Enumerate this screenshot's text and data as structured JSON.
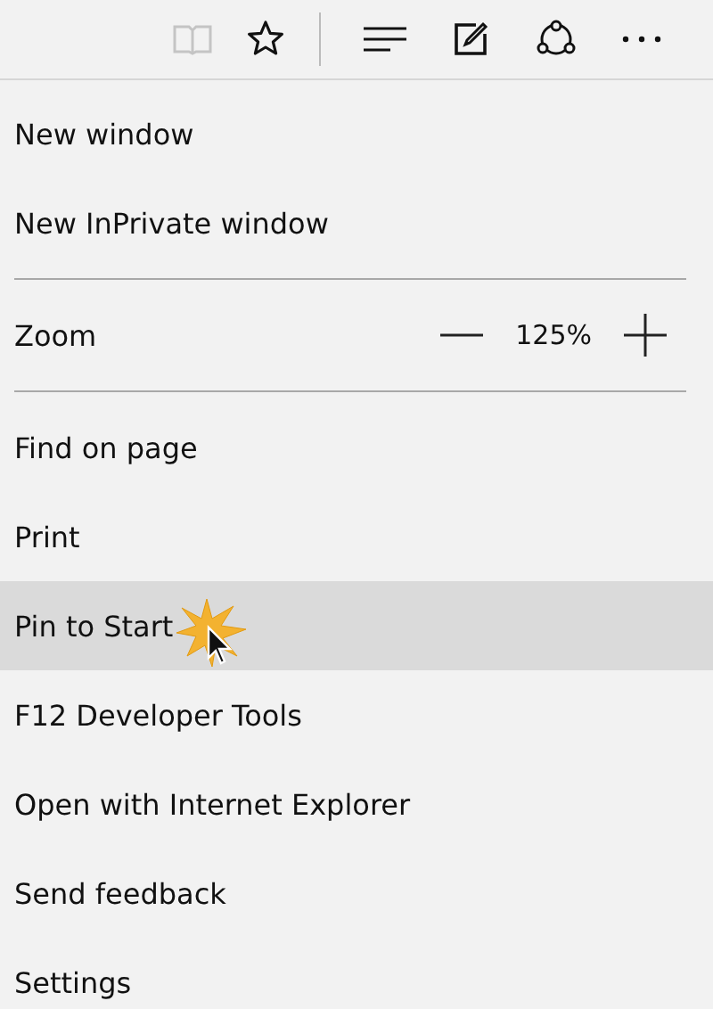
{
  "toolbar": {
    "buttons": [
      {
        "kind": "reading",
        "disabled": true
      },
      {
        "kind": "favorite"
      },
      {
        "kind": "separator"
      },
      {
        "kind": "hub"
      },
      {
        "kind": "note"
      },
      {
        "kind": "share"
      },
      {
        "kind": "more"
      }
    ]
  },
  "menu": [
    {
      "kind": "item",
      "label": "New window",
      "selected": false
    },
    {
      "kind": "item",
      "label": "New InPrivate window",
      "selected": false
    },
    {
      "kind": "divider"
    },
    {
      "kind": "zoom",
      "label": "Zoom",
      "value": "125%"
    },
    {
      "kind": "divider"
    },
    {
      "kind": "item",
      "label": "Find on page",
      "selected": false
    },
    {
      "kind": "item",
      "label": "Print",
      "selected": false
    },
    {
      "kind": "item",
      "label": "Pin to Start",
      "selected": true
    },
    {
      "kind": "item",
      "label": "F12 Developer Tools",
      "selected": false
    },
    {
      "kind": "item",
      "label": "Open with Internet Explorer",
      "selected": false
    },
    {
      "kind": "item",
      "label": "Send feedback",
      "selected": false
    },
    {
      "kind": "item",
      "label": "Settings",
      "selected": false
    }
  ]
}
